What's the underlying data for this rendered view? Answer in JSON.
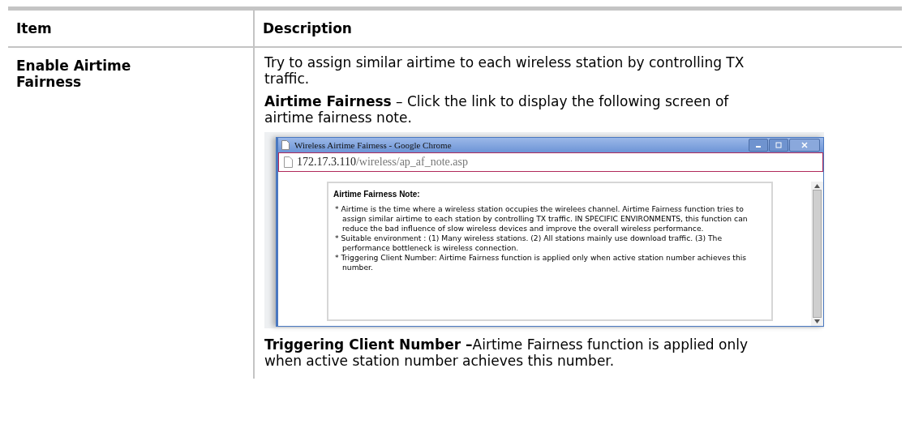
{
  "table": {
    "columns": [
      "Item",
      "Description"
    ],
    "rows": [
      {
        "item": "Enable Airtime Fairness",
        "paragraphs": [
          {
            "kind": "text",
            "text": "Try to assign similar airtime to each wireless station by controlling TX traffic."
          },
          {
            "kind": "text",
            "text": "**Airtime Fairness** – Click the link to display the following screen of airtime fairness note."
          },
          {
            "kind": "screenshot",
            "window": {
              "title": "Wireless Airtime Fairness - Google Chrome",
              "url_host": "172.17.3.110",
              "url_path": "/wireless/ap_af_note.asp",
              "note": {
                "heading": "Airtime Fairness Note:",
                "items": [
                  "* Airtime is the time where a wireless station occupies the wirelees channel. Airtime Fairness function tries to assign similar airtime to each station by controlling TX traffic. IN SPECIFIC ENVIRONMENTS, this function can reduce the bad influence of slow wireless devices and improve the overall wireless performance.",
                  "* Suitable environment : (1) Many wireless stations. (2) All stations mainly use download traffic. (3) The performance bottleneck is wireless connection.",
                  "* Triggering Client Number: Airtime Fairness function is applied only when active station number achieves this number."
                ]
              }
            }
          },
          {
            "kind": "text",
            "text": "**Triggering Client Number –**Airtime Fairness function is applied only when active station number achieves this number."
          }
        ]
      }
    ]
  }
}
